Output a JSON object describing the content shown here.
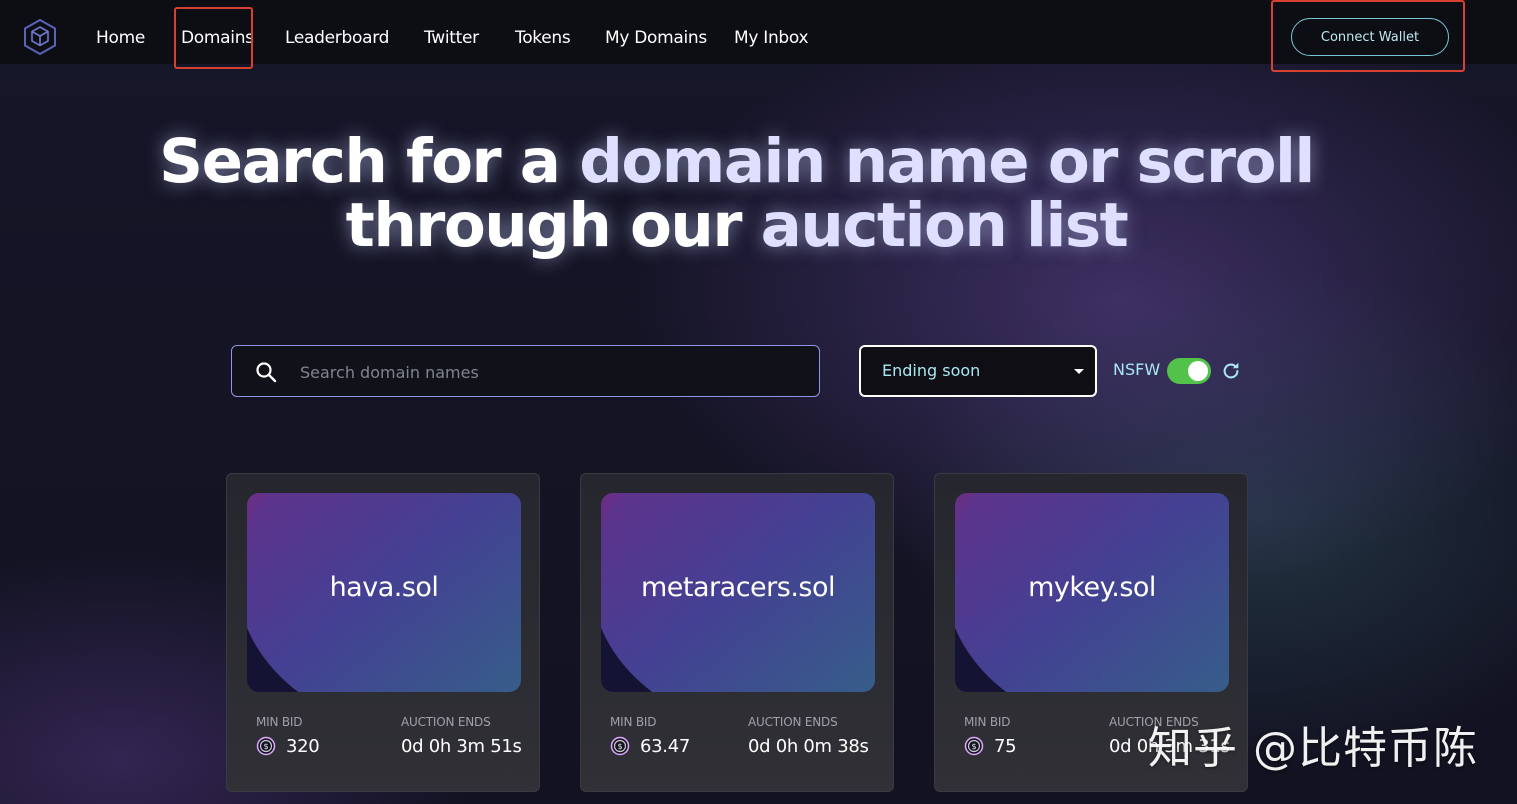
{
  "nav": {
    "links": [
      "Home",
      "Domains",
      "Leaderboard",
      "Twitter",
      "Tokens",
      "My Domains",
      "My Inbox"
    ],
    "connect_label": "Connect Wallet"
  },
  "hero": {
    "line1_a": "Search for a ",
    "line1_b": "domain name or scroll",
    "line2_a": "through our ",
    "line2_b": "auction list"
  },
  "filters": {
    "search_placeholder": "Search domain names",
    "search_value": "",
    "sort_selected": "Ending soon",
    "nsfw_label": "NSFW",
    "nsfw_on": true
  },
  "cards": [
    {
      "name": "hava.sol",
      "min_bid_label": "MIN BID",
      "min_bid": "320",
      "ends_label": "AUCTION ENDS",
      "ends": "0d 0h 3m 51s"
    },
    {
      "name": "metaracers.sol",
      "min_bid_label": "MIN BID",
      "min_bid": "63.47",
      "ends_label": "AUCTION ENDS",
      "ends": "0d 0h 0m 38s"
    },
    {
      "name": "mykey.sol",
      "min_bid_label": "MIN BID",
      "min_bid": "75",
      "ends_label": "AUCTION ENDS",
      "ends": "0d 0h 3m 31s"
    }
  ],
  "watermark": "知乎 @比特币陈",
  "icons": {
    "logo": "cube-logo-icon",
    "search": "search-icon",
    "sort": "caret-down-icon",
    "refresh": "refresh-icon",
    "coin": "usdc-coin-icon"
  },
  "colors": {
    "accent_cyan": "#a9e8f1",
    "toggle_on": "#52c24a",
    "highlight_box": "#d8402f"
  }
}
